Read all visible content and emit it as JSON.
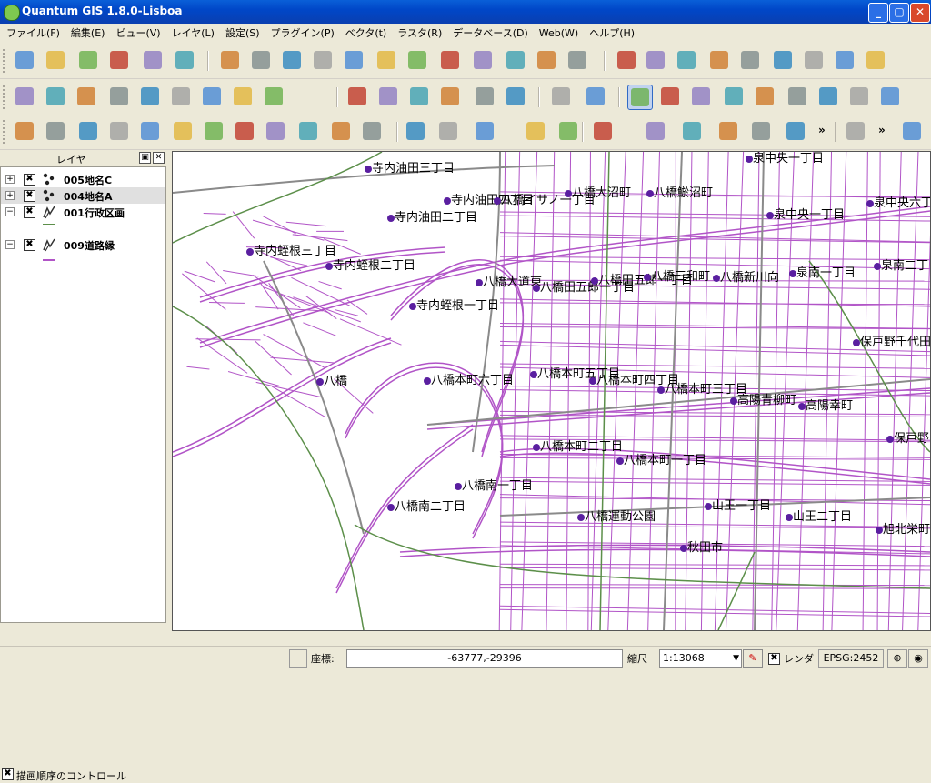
{
  "window": {
    "title": "Quantum GIS 1.8.0-Lisboa",
    "min_label": "_",
    "max_label": "▢",
    "close_label": "✕"
  },
  "menubar": {
    "items": [
      "ファイル(F)",
      "編集(E)",
      "ビュー(V)",
      "レイヤ(L)",
      "設定(S)",
      "プラグイン(P)",
      "ベクタ(t)",
      "ラスタ(R)",
      "データベース(D)",
      "Web(W)",
      "ヘルプ(H)"
    ]
  },
  "toolbar": {
    "overflow_label": "»",
    "pan_active": true,
    "accent_color": "#316ac5"
  },
  "layers_panel": {
    "title": "レイヤ",
    "float_label": "▣",
    "close_label": "✕",
    "layers": [
      {
        "name": "005地名C",
        "expander": "+",
        "checked": "✖",
        "icon": "point-layer-icon",
        "selected": false
      },
      {
        "name": "004地名A",
        "expander": "+",
        "checked": "✖",
        "icon": "point-layer-icon",
        "selected": true
      },
      {
        "name": "001行政区画",
        "expander": "−",
        "checked": "✖",
        "icon": "polygon-layer-icon",
        "selected": false
      },
      {
        "name": "009道路縁",
        "expander": "−",
        "checked": "✖",
        "icon": "line-layer-icon",
        "selected": false
      }
    ],
    "draw_order": {
      "checked": "✖",
      "label": "描画順序のコントロール"
    }
  },
  "map": {
    "road_color": "#b154c7",
    "boundary_color": "#5c8f4a",
    "point_color": "#5a1fa0",
    "places": [
      {
        "name": "寺内油田三丁目"
      },
      {
        "name": "寺内油田四丁目"
      },
      {
        "name": "八橋イサノ一丁目"
      },
      {
        "name": "八橋大沼町"
      },
      {
        "name": "八橋鯲沼町"
      },
      {
        "name": "泉中央一丁目"
      },
      {
        "name": "泉中央一丁目"
      },
      {
        "name": "泉中央六丁"
      },
      {
        "name": "寺内油田二丁目"
      },
      {
        "name": "寺内蛭根三丁目"
      },
      {
        "name": "寺内蛭根二丁目"
      },
      {
        "name": "八橋大道東"
      },
      {
        "name": "八橋田五郎一丁目"
      },
      {
        "name": "八橋田五郎一丁目"
      },
      {
        "name": "八橋三和町"
      },
      {
        "name": "八橋新川向"
      },
      {
        "name": "泉南一丁目"
      },
      {
        "name": "泉南二丁"
      },
      {
        "name": "寺内蛭根一丁目"
      },
      {
        "name": "保戸野千代田"
      },
      {
        "name": "八橋"
      },
      {
        "name": "八橋本町六丁目"
      },
      {
        "name": "八橋本町五丁目"
      },
      {
        "name": "八橋本町四丁目"
      },
      {
        "name": "八橋本町三丁目"
      },
      {
        "name": "高陽青柳町"
      },
      {
        "name": "高陽幸町"
      },
      {
        "name": "八橋本町二丁目"
      },
      {
        "name": "保戸野"
      },
      {
        "name": "八橋本町一丁目"
      },
      {
        "name": "八橋南一丁目"
      },
      {
        "name": "八橋南二丁目"
      },
      {
        "name": "八橋運動公園"
      },
      {
        "name": "山王一丁目"
      },
      {
        "name": "山王二丁目"
      },
      {
        "name": "秋田市"
      },
      {
        "name": "旭北栄町"
      }
    ]
  },
  "statusbar": {
    "coord_label": "座標:",
    "coord_value": "-63777,-29396",
    "scale_label": "縮尺",
    "scale_value": "1:13068",
    "render_checked": "✖",
    "render_label": "レンダ",
    "crs": "EPSG:2452"
  }
}
